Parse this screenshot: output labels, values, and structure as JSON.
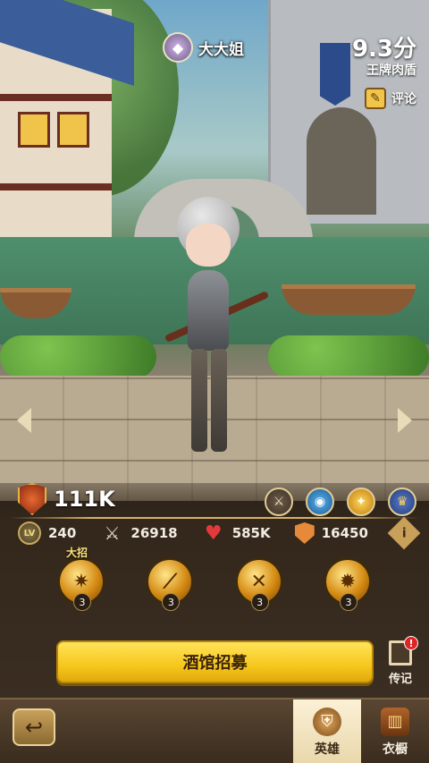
{
  "hero": {
    "name": "大大姐",
    "rank_icon": "crystal-rank-icon",
    "score": "9.3分",
    "tagline": "王牌肉盾",
    "review_label": "评论",
    "review_icon": "review-pencil-icon"
  },
  "stats": {
    "power": "111K",
    "level": "240",
    "level_tag": "LV",
    "attack": "26918",
    "hp": "585K",
    "defense": "16450"
  },
  "factions": [
    "weapon-faction-icon",
    "water-element-icon",
    "light-element-icon",
    "guardian-class-icon"
  ],
  "skills": [
    {
      "level": "3",
      "tag": "大招",
      "icon": "ultimate-skill-icon"
    },
    {
      "level": "3",
      "icon": "slash-skill-icon"
    },
    {
      "level": "3",
      "icon": "crossed-swords-skill-icon"
    },
    {
      "level": "3",
      "icon": "radiant-burst-skill-icon"
    }
  ],
  "actions": {
    "recruit_label": "酒馆招募",
    "legend_label": "传记",
    "legend_badge": "!"
  },
  "nav": {
    "hero_label": "英雄",
    "wardrobe_label": "衣橱"
  },
  "colors": {
    "accent_gold": "#f6c71c",
    "panel_brown": "#3a2d21",
    "alert_red": "#e02424"
  }
}
